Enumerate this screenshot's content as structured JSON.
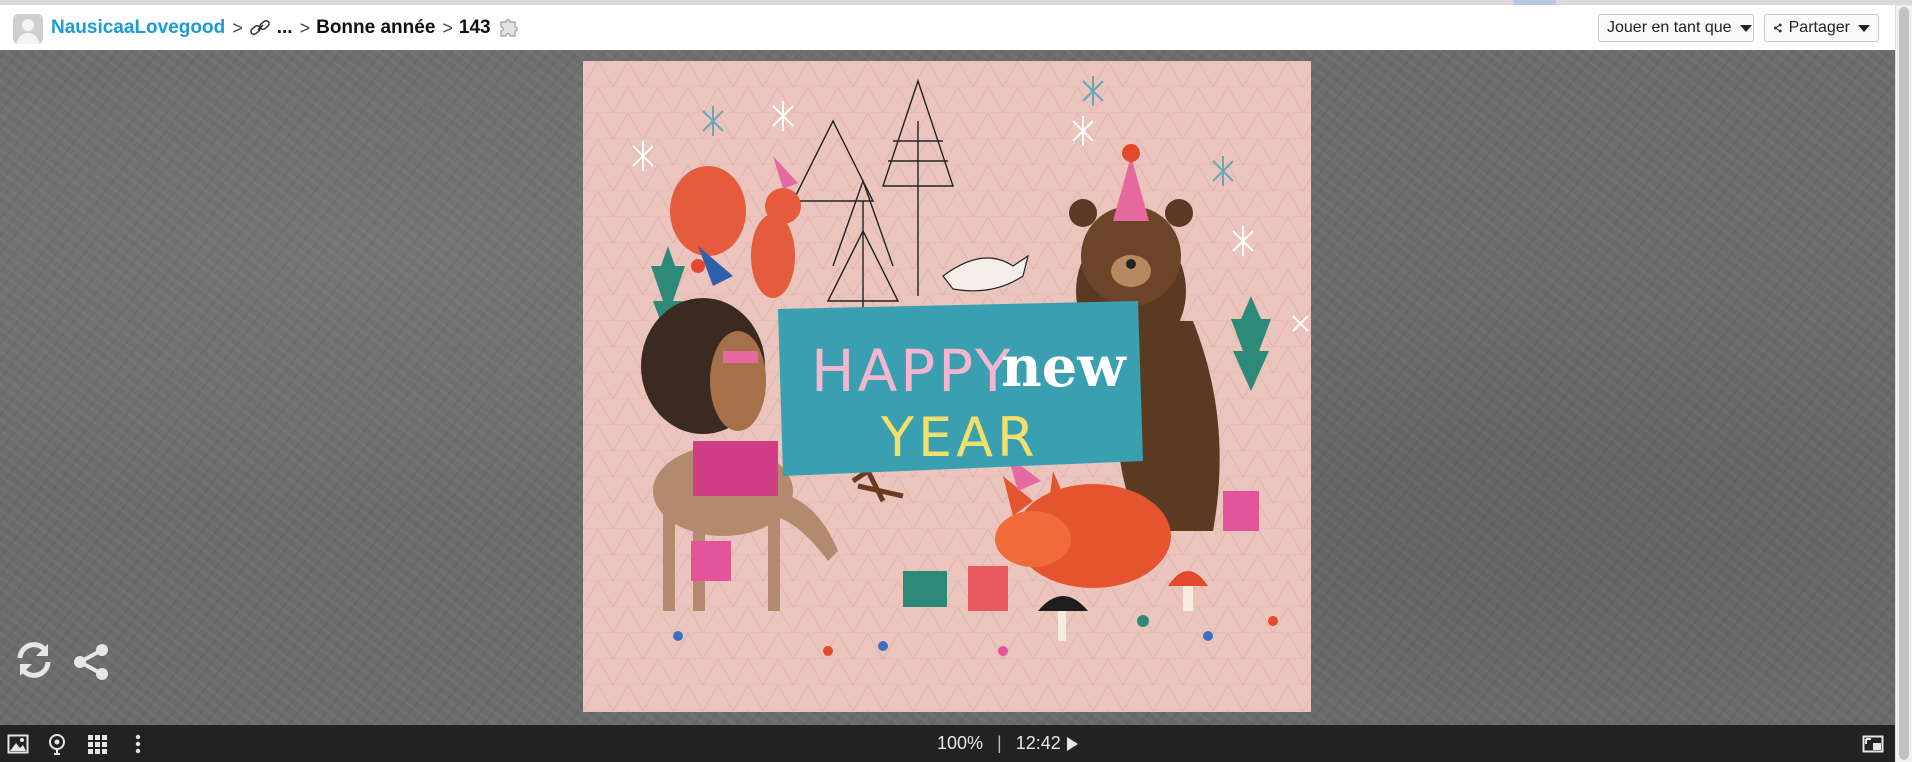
{
  "header": {
    "user_name": "NausicaaLovegood",
    "ellipsis": "...",
    "collection": "Bonne année",
    "piece_count": "143",
    "play_as_button": "Jouer en tant que",
    "share_button": "Partager"
  },
  "puzzle_image": {
    "line1": "HAPPY",
    "line1b": "new",
    "line2": "YEAR"
  },
  "status": {
    "progress": "100%",
    "separator": "|",
    "time": "12:42"
  },
  "colors": {
    "link": "#1a9bd6",
    "toolbar": "#222222",
    "stage": "#6c6c6c",
    "card_background": "#e9c2bb",
    "banner": "#3a9fb0"
  },
  "icons": {
    "link": "link-icon",
    "puzzle": "puzzle-piece-icon",
    "refresh": "refresh-icon",
    "share": "share-icon",
    "image": "image-icon",
    "piece_picker": "piece-picker-icon",
    "grid": "grid-icon",
    "more": "more-vertical-icon",
    "fullscreen": "fullscreen-icon"
  }
}
